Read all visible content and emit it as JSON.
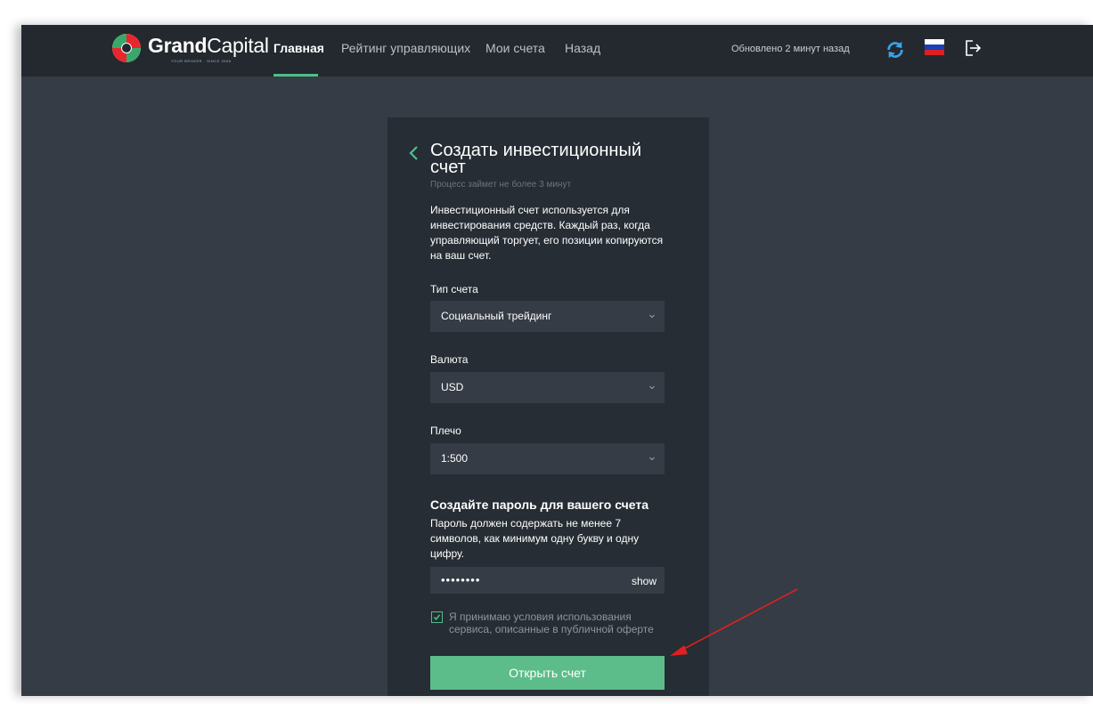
{
  "header": {
    "logo": {
      "bold": "Grand",
      "light": "Capital",
      "tagline": "YOUR BROKER · SINCE 2006"
    },
    "nav": [
      {
        "label": "Главная",
        "active": true
      },
      {
        "label": "Рейтинг управляющих",
        "active": false
      },
      {
        "label": "Мои счета",
        "active": false
      },
      {
        "label": "Назад",
        "active": false
      }
    ],
    "updated": "Обновлено 2 минут назад",
    "icons": [
      "refresh-icon",
      "russia-flag-icon",
      "logout-icon"
    ]
  },
  "form": {
    "title": "Создать инвестиционный счет",
    "subtitle": "Процесс займет не более 3 минут",
    "description": "Инвестиционный счет используется для инвестирования средств. Каждый раз, когда управляющий торгует, его позиции копируются на ваш счет.",
    "account_type": {
      "label": "Тип счета",
      "value": "Социальный трейдинг"
    },
    "currency": {
      "label": "Валюта",
      "value": "USD"
    },
    "leverage": {
      "label": "Плечо",
      "value": "1:500"
    },
    "password": {
      "heading": "Создайте пароль для вашего счета",
      "hint": "Пароль должен содержать не менее 7 символов, как минимум одну букву и одну цифру.",
      "masked_value": "••••••••",
      "show_label": "show"
    },
    "terms": {
      "checked": true,
      "label": "Я принимаю условия использования сервиса, описанные в публичной оферте"
    },
    "submit_label": "Открыть счет"
  },
  "colors": {
    "accent": "#5cbd8a",
    "topbar": "#23292f",
    "background": "#353c45",
    "panel": "#262d34",
    "annotation_arrow": "#e02020"
  }
}
